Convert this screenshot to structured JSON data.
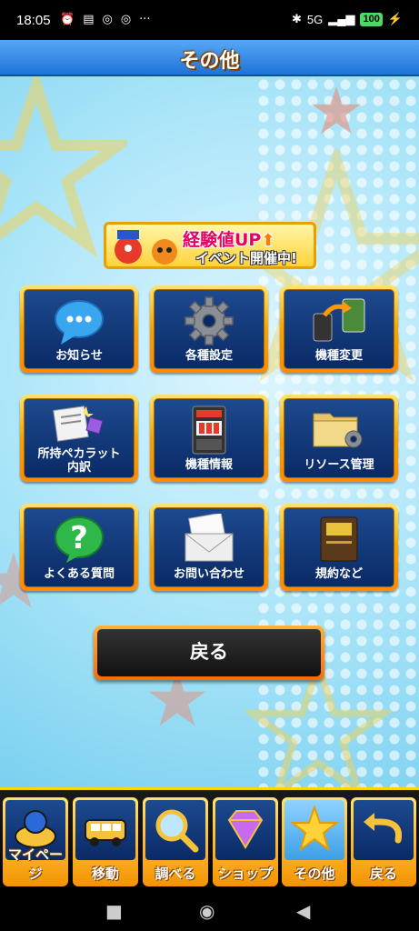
{
  "status": {
    "time": "18:05",
    "network": "5G",
    "battery": "100"
  },
  "title": "その他",
  "banner": {
    "line1": "経験値UP",
    "line2": "イベント開催中!"
  },
  "grid": [
    {
      "label": "お知らせ",
      "icon": "speech-bubble-icon"
    },
    {
      "label": "各種設定",
      "icon": "gear-icon"
    },
    {
      "label": "機種変更",
      "icon": "device-transfer-icon"
    },
    {
      "label": "所持ペカラット\n内訳",
      "icon": "document-gem-icon"
    },
    {
      "label": "機種情報",
      "icon": "slot-machine-icon"
    },
    {
      "label": "リソース管理",
      "icon": "folder-gear-icon"
    },
    {
      "label": "よくある質問",
      "icon": "question-icon"
    },
    {
      "label": "お問い合わせ",
      "icon": "envelope-icon"
    },
    {
      "label": "規約など",
      "icon": "book-icon"
    }
  ],
  "back_button": "戻る",
  "tabs": [
    {
      "label": "マイページ",
      "icon": "mypage-icon"
    },
    {
      "label": "移動",
      "icon": "car-icon"
    },
    {
      "label": "調べる",
      "icon": "magnifier-icon"
    },
    {
      "label": "ショップ",
      "icon": "diamond-icon"
    },
    {
      "label": "その他",
      "icon": "star-icon",
      "active": true
    },
    {
      "label": "戻る",
      "icon": "return-arrow-icon"
    }
  ],
  "colors": {
    "accent": "#f5a300",
    "panel": "#0a2a66",
    "title_bar": "#1e73d9"
  }
}
